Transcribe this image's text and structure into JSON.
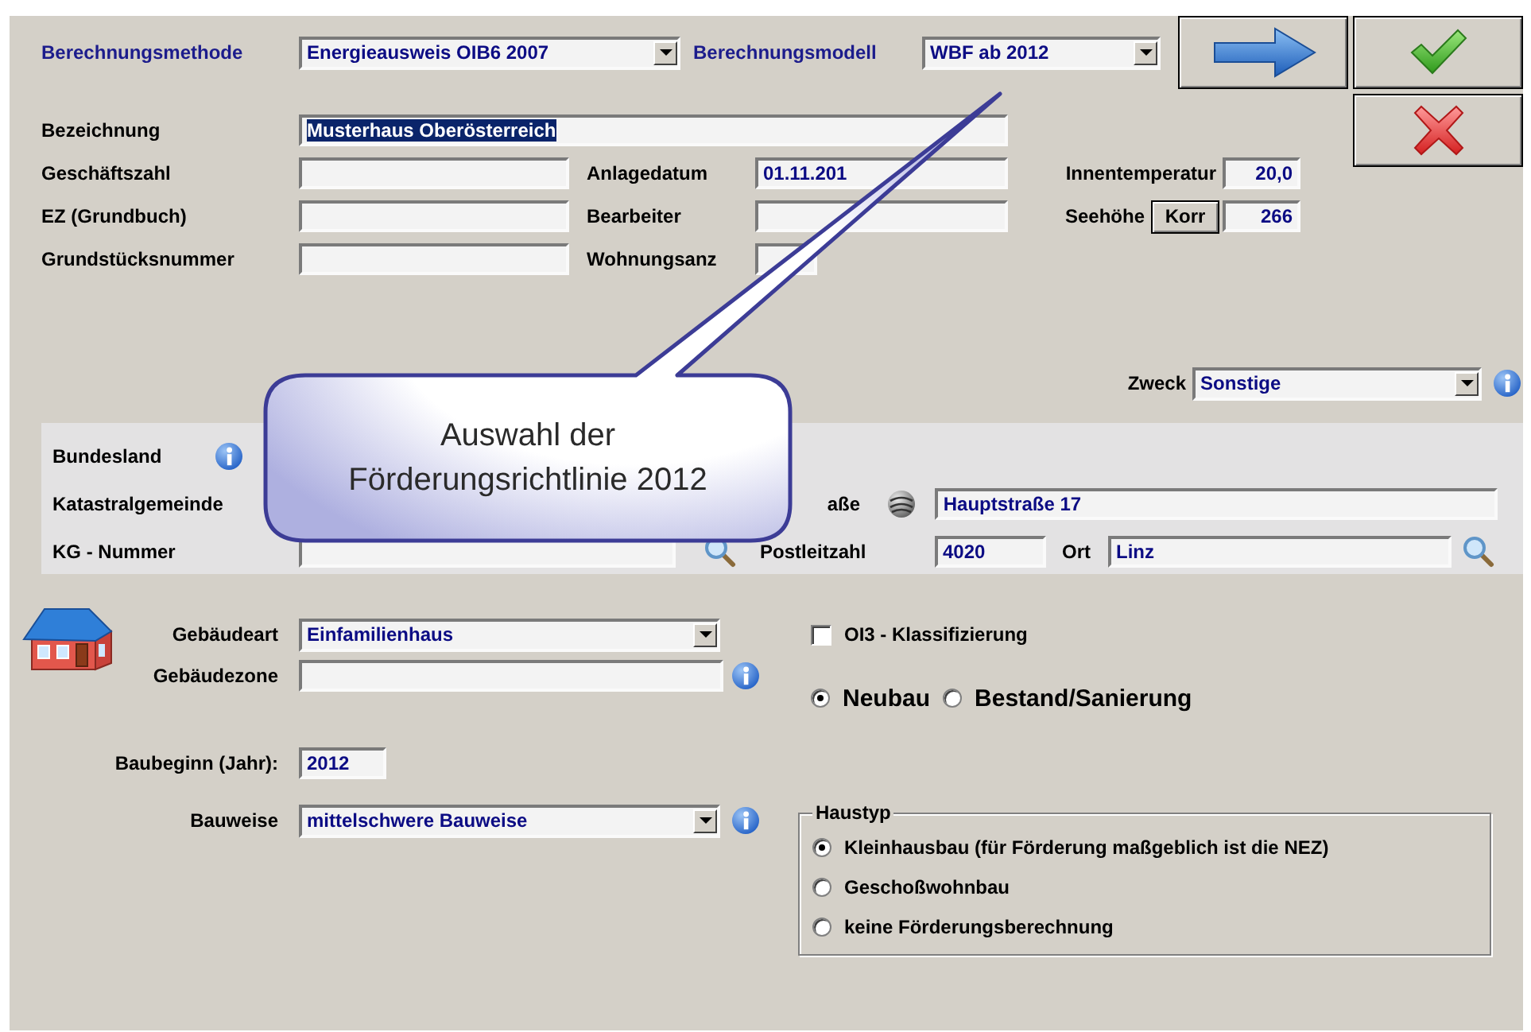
{
  "calculation": {
    "method": {
      "label": "Berechnungsmethode",
      "value": "Energieausweis OIB6 2007"
    },
    "model": {
      "label": "Berechnungsmodell",
      "value": "WBF ab 2012"
    }
  },
  "action_buttons": [
    {
      "kind": "next"
    },
    {
      "kind": "confirm"
    },
    {
      "kind": "cancel"
    }
  ],
  "general": {
    "bezeichnung": {
      "label": "Bezeichnung",
      "value": "Musterhaus Oberösterreich",
      "selected": true
    },
    "geschaeftszahl": {
      "label": "Geschäftszahl"
    },
    "anlagedatum": {
      "label": "Anlagedatum",
      "value": "01.11.201"
    },
    "innentemperatur": {
      "label": "Innentemperatur",
      "value": "20,0"
    },
    "ez": {
      "label": "EZ (Grundbuch)"
    },
    "bearbeiter": {
      "label": "Bearbeiter"
    },
    "seehoehe": {
      "label": "Seehöhe",
      "button": "Korr",
      "value": "266"
    },
    "grundstuecksnummer": {
      "label": "Grundstücksnummer"
    },
    "wohnungsanzahl": {
      "label": "Wohnungsanz"
    },
    "zweck": {
      "label": "Zweck",
      "value": "Sonstige"
    }
  },
  "location": {
    "bundesland": {
      "label": "Bundesland"
    },
    "katastralgemeinde": {
      "label": "Katastralgemeinde"
    },
    "strasse": {
      "label": "aße",
      "value": "Hauptstraße 17"
    },
    "kg_nummer": {
      "label": "KG - Nummer"
    },
    "postleitzahl": {
      "label": "Postleitzahl",
      "value": "4020"
    },
    "ort": {
      "label": "Ort",
      "value": "Linz"
    }
  },
  "building": {
    "gebaeudeart": {
      "label": "Gebäudeart",
      "value": "Einfamilienhaus"
    },
    "gebaeudezone": {
      "label": "Gebäudezone"
    },
    "baubeginn": {
      "label": "Baubeginn (Jahr):",
      "value": "2012"
    },
    "bauweise": {
      "label": "Bauweise",
      "value": "mittelschwere Bauweise"
    }
  },
  "oi3": {
    "label": "OI3 - Klassifizierung",
    "checked": false
  },
  "construction_type": [
    {
      "label": "Neubau",
      "selected": true
    },
    {
      "label": "Bestand/Sanierung",
      "selected": false
    }
  ],
  "haustyp": {
    "title": "Haustyp",
    "options": [
      {
        "label": "Kleinhausbau (für Förderung maßgeblich ist die NEZ)",
        "selected": true
      },
      {
        "label": "Geschoßwohnbau",
        "selected": false
      },
      {
        "label": "keine Förderungsberechnung",
        "selected": false
      }
    ]
  },
  "callout": {
    "text": "Auswahl der Förderungsrichtlinie 2012"
  }
}
